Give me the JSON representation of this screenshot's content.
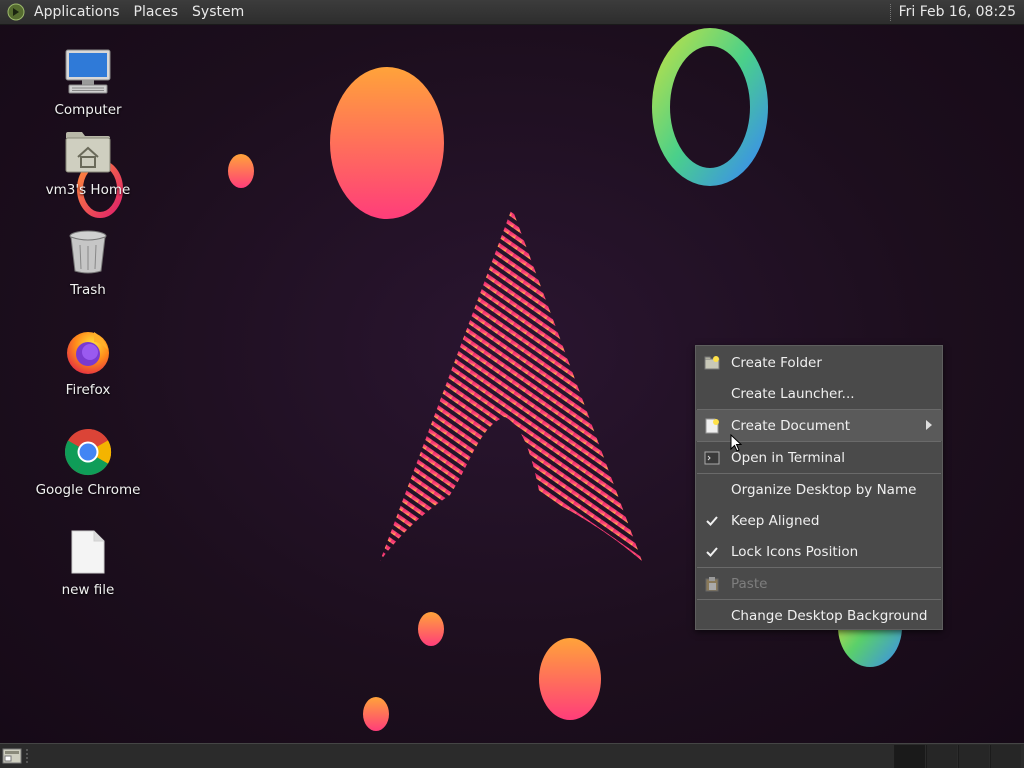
{
  "top_panel": {
    "menus": [
      "Applications",
      "Places",
      "System"
    ],
    "clock": "Fri Feb 16, 08:25"
  },
  "desktop_icons": [
    {
      "label": "Computer",
      "icon": "computer-icon"
    },
    {
      "label": "vm3's Home",
      "icon": "home-folder-icon"
    },
    {
      "label": "Trash",
      "icon": "trash-icon"
    },
    {
      "label": "Firefox",
      "icon": "firefox-icon"
    },
    {
      "label": "Google Chrome",
      "icon": "chrome-icon"
    },
    {
      "label": "new file",
      "icon": "file-icon"
    }
  ],
  "context_menu": {
    "items": [
      {
        "label": "Create Folder",
        "icon": "folder-new-icon"
      },
      {
        "label": "Create Launcher...",
        "icon": ""
      },
      {
        "label": "Create Document",
        "icon": "document-new-icon",
        "submenu": true,
        "highlighted": true
      },
      {
        "label": "Open in Terminal",
        "icon": "terminal-icon"
      },
      {
        "label": "Organize Desktop by Name",
        "icon": ""
      },
      {
        "label": "Keep Aligned",
        "icon": "check-icon",
        "checked": true
      },
      {
        "label": "Lock Icons Position",
        "icon": "check-icon",
        "checked": true
      },
      {
        "label": "Paste",
        "icon": "paste-icon",
        "disabled": true
      },
      {
        "label": "Change Desktop Background",
        "icon": ""
      }
    ]
  },
  "colors": {
    "panel_bg": "#2d2d2d",
    "menu_bg": "#4a4a4a",
    "wallpaper_bg": "#1c0e1d",
    "accent_pink": "#e0206a",
    "accent_orange": "#ff9a3c"
  }
}
